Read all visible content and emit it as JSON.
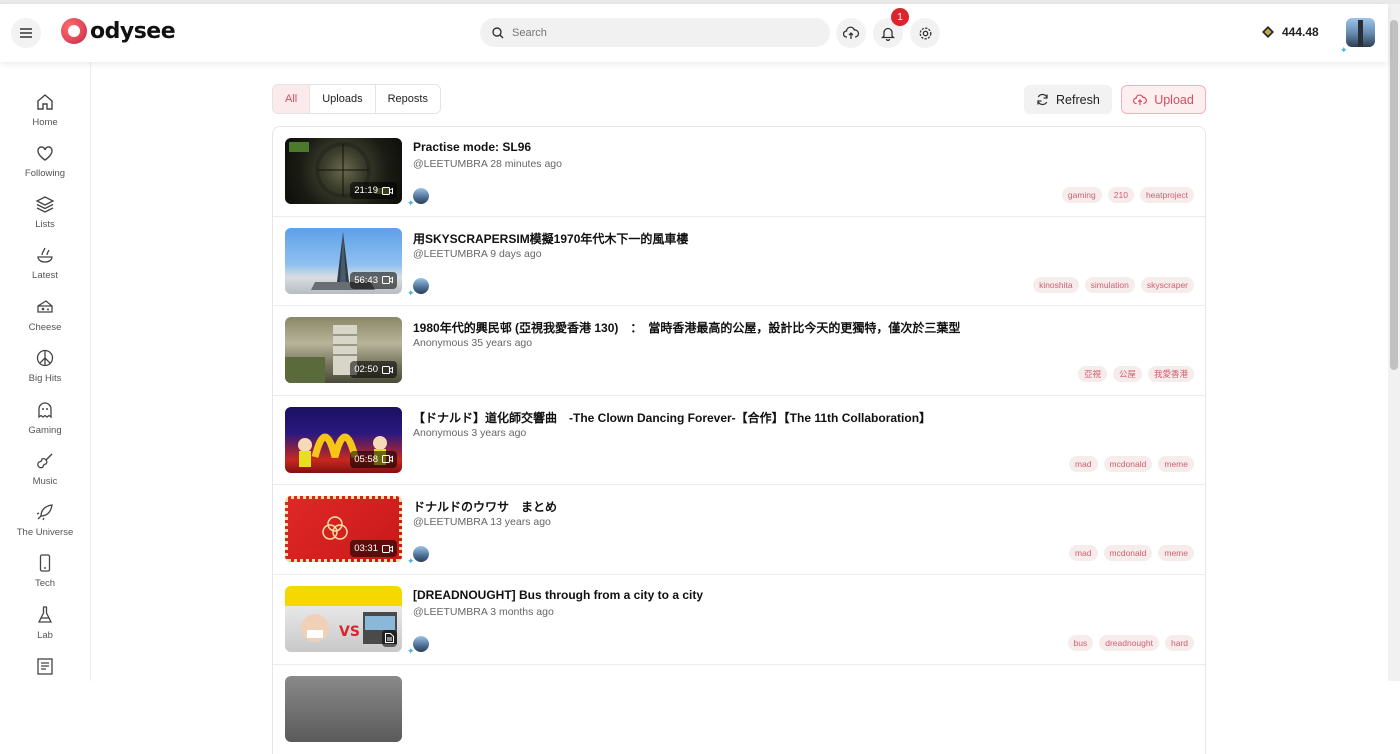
{
  "header": {
    "logo_text": "odysee",
    "search_placeholder": "Search",
    "notification_count": "1",
    "balance": "444.48"
  },
  "sidebar": {
    "items": [
      {
        "label": "Home",
        "icon": "home-icon"
      },
      {
        "label": "Following",
        "icon": "heart-icon"
      },
      {
        "label": "Lists",
        "icon": "layers-icon"
      },
      {
        "label": "Latest",
        "icon": "latest-icon"
      },
      {
        "label": "Cheese",
        "icon": "cheese-icon"
      },
      {
        "label": "Big Hits",
        "icon": "peace-icon"
      },
      {
        "label": "Gaming",
        "icon": "ghost-icon"
      },
      {
        "label": "Music",
        "icon": "guitar-icon"
      },
      {
        "label": "The Universe",
        "icon": "rocket-icon"
      },
      {
        "label": "Tech",
        "icon": "phone-icon"
      },
      {
        "label": "Lab",
        "icon": "flask-icon"
      }
    ]
  },
  "filters": {
    "all": "All",
    "uploads": "Uploads",
    "reposts": "Reposts"
  },
  "actions": {
    "refresh": "Refresh",
    "upload": "Upload"
  },
  "items": [
    {
      "title": "Practise mode: SL96",
      "channel": "@LEETUMBRA",
      "age": "28 minutes ago",
      "duration": "21:19",
      "type": "video",
      "tags": [
        "gaming",
        "210",
        "heatproject"
      ],
      "has_avatar": true
    },
    {
      "title": "用SKYSCRAPERSIM模擬1970年代木下一的風車樓",
      "channel": "@LEETUMBRA",
      "age": "9 days ago",
      "duration": "56:43",
      "type": "video",
      "tags": [
        "kinoshita",
        "simulation",
        "skyscraper"
      ],
      "has_avatar": true
    },
    {
      "title": "1980年代的興民邨 (亞視我愛香港 130)　：　當時香港最高的公屋，設計比今天的更獨特，僅次於三葉型",
      "channel": "Anonymous",
      "age": "35 years ago",
      "duration": "02:50",
      "type": "video",
      "tags": [
        "亞視",
        "公屋",
        "我愛香港"
      ],
      "has_avatar": false
    },
    {
      "title": "【ドナルド】道化師交響曲　-The Clown Dancing Forever-【合作】【The 11th Collaboration】",
      "channel": "Anonymous",
      "age": "3 years ago",
      "duration": "05:58",
      "type": "video",
      "tags": [
        "mad",
        "mcdonald",
        "meme"
      ],
      "has_avatar": false
    },
    {
      "title": "ドナルドのウワサ　まとめ",
      "channel": "@LEETUMBRA",
      "age": "13 years ago",
      "duration": "03:31",
      "type": "video",
      "tags": [
        "mad",
        "mcdonald",
        "meme"
      ],
      "has_avatar": true
    },
    {
      "title": "[DREADNOUGHT] Bus through from a city to a city",
      "channel": "@LEETUMBRA",
      "age": "3 months ago",
      "duration": "",
      "type": "document",
      "tags": [
        "bus",
        "dreadnought",
        "hard"
      ],
      "has_avatar": true
    }
  ],
  "colors": {
    "brand": "#e2495b",
    "tag_bg": "#f6ecec",
    "tag_text": "#d0606e"
  }
}
